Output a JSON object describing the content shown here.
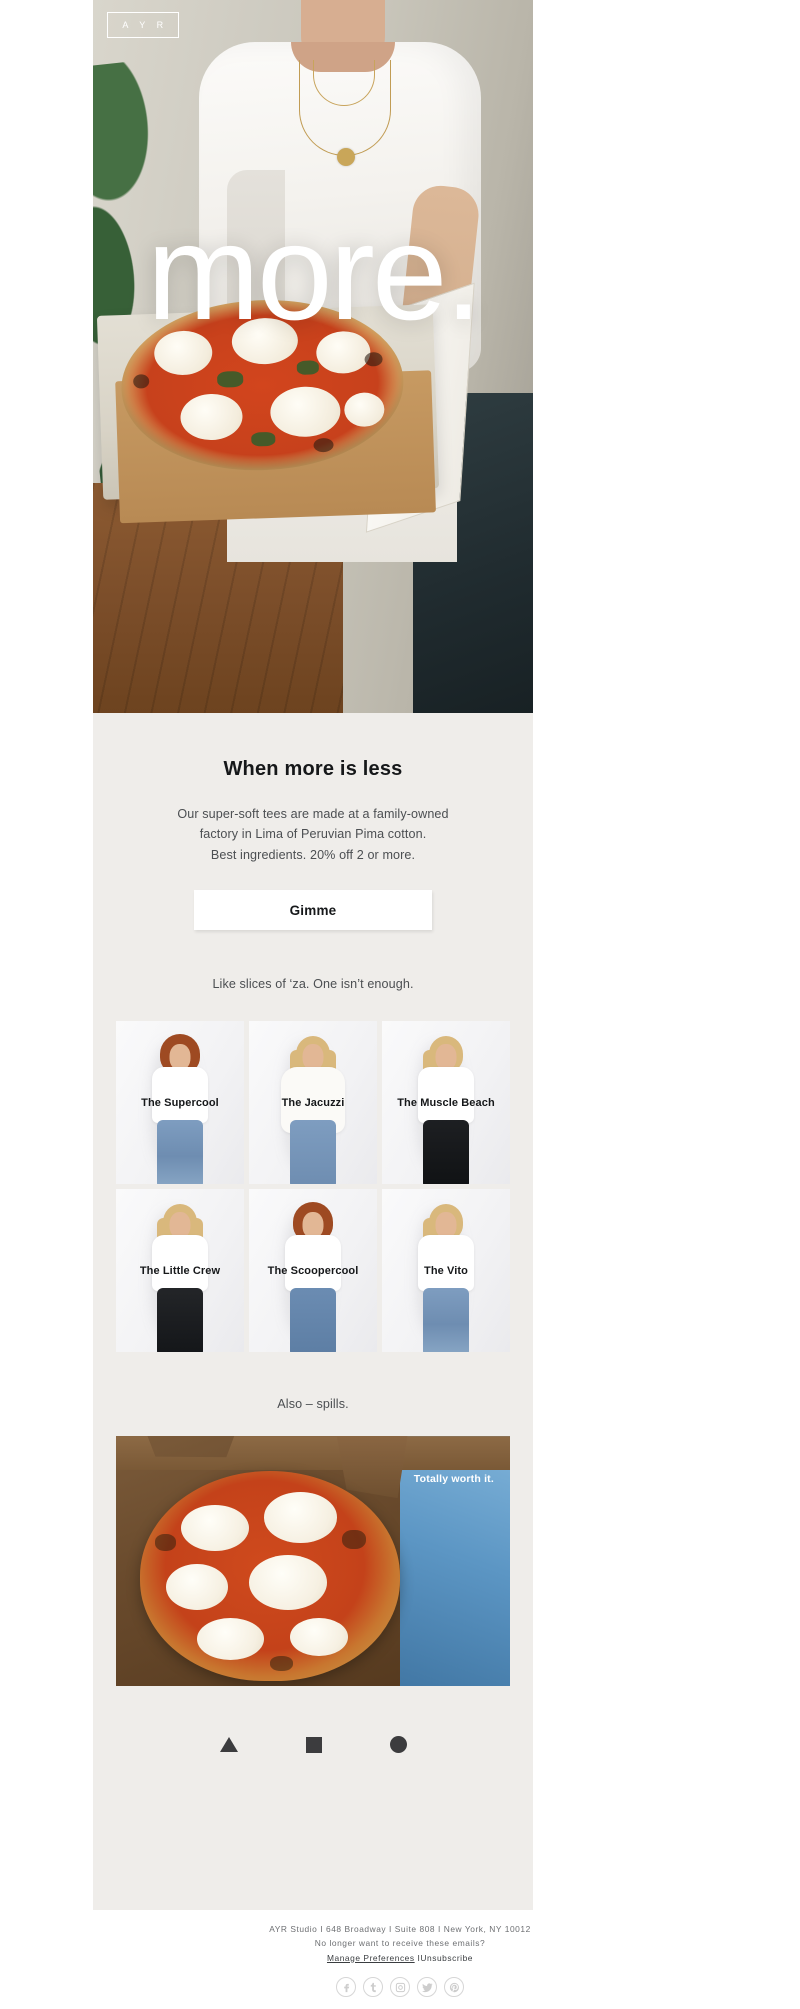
{
  "brand": {
    "logo_text": "A Y R"
  },
  "hero": {
    "title": "more.",
    "alt": "woman-holding-pizza-box"
  },
  "main": {
    "headline": "When more is less",
    "body_lines": [
      "Our super-soft tees are made at a family-owned",
      "factory in Lima of Peruvian Pima cotton.",
      "Best ingredients. 20% off 2 or more."
    ],
    "cta_label": "Gimme",
    "subcopy": "Like slices of ‘za. One isn’t enough.",
    "spills_copy": "Also – spills."
  },
  "products": [
    {
      "name": "The Supercool"
    },
    {
      "name": "The Jacuzzi"
    },
    {
      "name": "The Muscle Beach"
    },
    {
      "name": "The Little Crew"
    },
    {
      "name": "The Scoopercool"
    },
    {
      "name": "The Vito"
    }
  ],
  "spills": {
    "caption": "Totally worth it."
  },
  "shapes": [
    {
      "icon": "triangle-shape"
    },
    {
      "icon": "square-shape"
    },
    {
      "icon": "circle-shape"
    }
  ],
  "footer": {
    "address": "AYR Studio I 648 Broadway I Suite 808 I New York, NY 10012",
    "optout_question": "No longer want to receive these emails?",
    "manage_label": "Manage Preferences",
    "separator": " I",
    "unsubscribe_label": "Unsubscribe",
    "socials": [
      {
        "name": "facebook",
        "glyph": "f"
      },
      {
        "name": "tumblr",
        "glyph": "t"
      },
      {
        "name": "instagram",
        "glyph": "▣"
      },
      {
        "name": "twitter",
        "glyph": "ᴠ"
      },
      {
        "name": "pinterest",
        "glyph": "ℙ"
      }
    ]
  },
  "colors": {
    "page_bg": "#efedea",
    "text_dark": "#16181a",
    "text_body": "#4c4f52",
    "button_bg": "#ffffff",
    "footer_bg": "#ffffff",
    "shape_color": "#3c3c3e"
  }
}
